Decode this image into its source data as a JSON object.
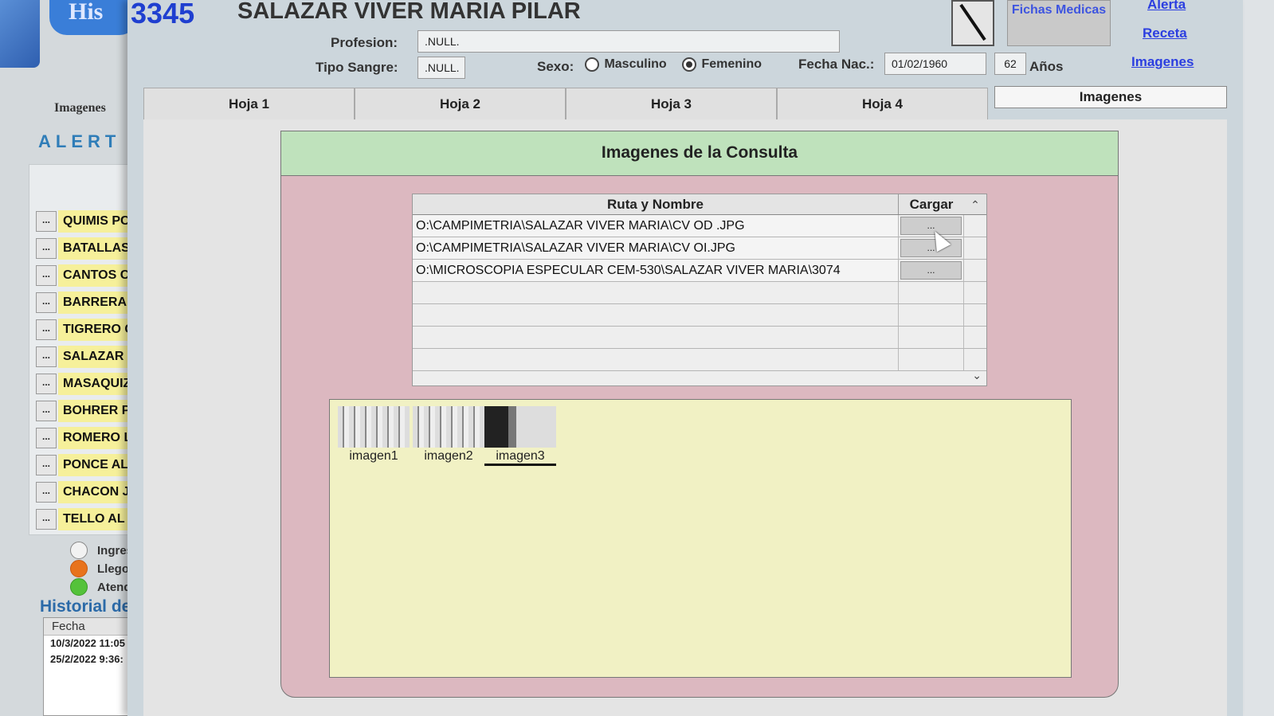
{
  "left": {
    "logo_text": "His",
    "imagenes_label": "Imagenes",
    "alert_title": "ALERT",
    "alert_items": [
      {
        "btn": "...",
        "name": "QUIMIS PC"
      },
      {
        "btn": "...",
        "name": "BATALLAS"
      },
      {
        "btn": "...",
        "name": "CANTOS C"
      },
      {
        "btn": "...",
        "name": "BARRERA"
      },
      {
        "btn": "...",
        "name": "TIGRERO C"
      },
      {
        "btn": "...",
        "name": "SALAZAR V"
      },
      {
        "btn": "...",
        "name": "MASAQUIZ"
      },
      {
        "btn": "...",
        "name": "BOHRER P"
      },
      {
        "btn": "...",
        "name": "ROMERO L"
      },
      {
        "btn": "...",
        "name": "PONCE AL"
      },
      {
        "btn": "...",
        "name": "CHACON J"
      },
      {
        "btn": "...",
        "name": "TELLO AL"
      }
    ],
    "legend": [
      {
        "label": "Ingres",
        "color": "#f2f2f2"
      },
      {
        "label": "Llego",
        "color": "#e8731c"
      },
      {
        "label": "Atend",
        "color": "#54c23a"
      }
    ],
    "history_title": "Historial de",
    "history_header": "Fecha",
    "history_rows": [
      "10/3/2022 11:05",
      "25/2/2022 9:36:"
    ]
  },
  "header": {
    "patient_id": "3345",
    "patient_name": "SALAZAR VIVER MARIA PILAR",
    "profesion_label": "Profesion:",
    "profesion_value": ".NULL.",
    "sangre_label": "Tipo Sangre:",
    "sangre_value": ".NULL.",
    "sexo_label": "Sexo:",
    "sexo_options": [
      "Masculino",
      "Femenino"
    ],
    "sexo_selected": "Femenino",
    "fecha_label": "Fecha Nac.:",
    "fecha_value": "01/02/1960",
    "edad_value": "62",
    "edad_unit": "Años",
    "fichas_label": "Fichas Medicas",
    "links": [
      "Alerta",
      "Receta",
      "Imagenes"
    ]
  },
  "tabs": [
    "Hoja 1",
    "Hoja 2",
    "Hoja 3",
    "Hoja 4"
  ],
  "active_tab": "Imagenes",
  "panel": {
    "title": "Imagenes de la Consulta",
    "col_path": "Ruta y Nombre",
    "col_load": "Cargar",
    "rows": [
      {
        "path": "O:\\CAMPIMETRIA\\SALAZAR VIVER MARIA\\CV OD .JPG",
        "load": "..."
      },
      {
        "path": "O:\\CAMPIMETRIA\\SALAZAR VIVER MARIA\\CV OI.JPG",
        "load": "..."
      },
      {
        "path": "O:\\MICROSCOPIA ESPECULAR CEM-530\\SALAZAR VIVER MARIA\\3074",
        "load": "..."
      }
    ],
    "thumbnails": [
      "imagen1",
      "imagen2",
      "imagen3"
    ],
    "active_thumbnail": "imagen3"
  }
}
